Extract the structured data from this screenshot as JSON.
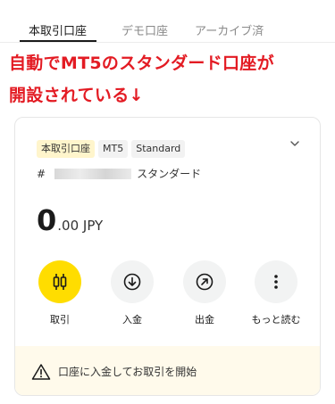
{
  "tabs": [
    {
      "label": "本取引口座",
      "active": true
    },
    {
      "label": "デモ口座",
      "active": false
    },
    {
      "label": "アーカイブ済",
      "active": false
    }
  ],
  "annotation": {
    "line1": "自動でMT5のスタンダード口座が",
    "line2": "開設されている↓",
    "color": "#e31b23"
  },
  "account": {
    "badges": [
      "本取引口座",
      "MT5",
      "Standard"
    ],
    "hash": "#",
    "type_label": "スタンダード",
    "balance_int": "0",
    "balance_dec": ".00 JPY"
  },
  "actions": [
    {
      "label": "取引",
      "icon": "candlestick-icon"
    },
    {
      "label": "入金",
      "icon": "arrow-down-circle-icon"
    },
    {
      "label": "出金",
      "icon": "arrow-up-right-circle-icon"
    },
    {
      "label": "もっと読む",
      "icon": "more-vertical-icon"
    }
  ],
  "notice": {
    "text": "口座に入金してお取引を開始"
  },
  "colors": {
    "accent_yellow": "#ffdd00",
    "notice_bg": "#fffaeb",
    "badge_live_bg": "#fff5cc"
  }
}
